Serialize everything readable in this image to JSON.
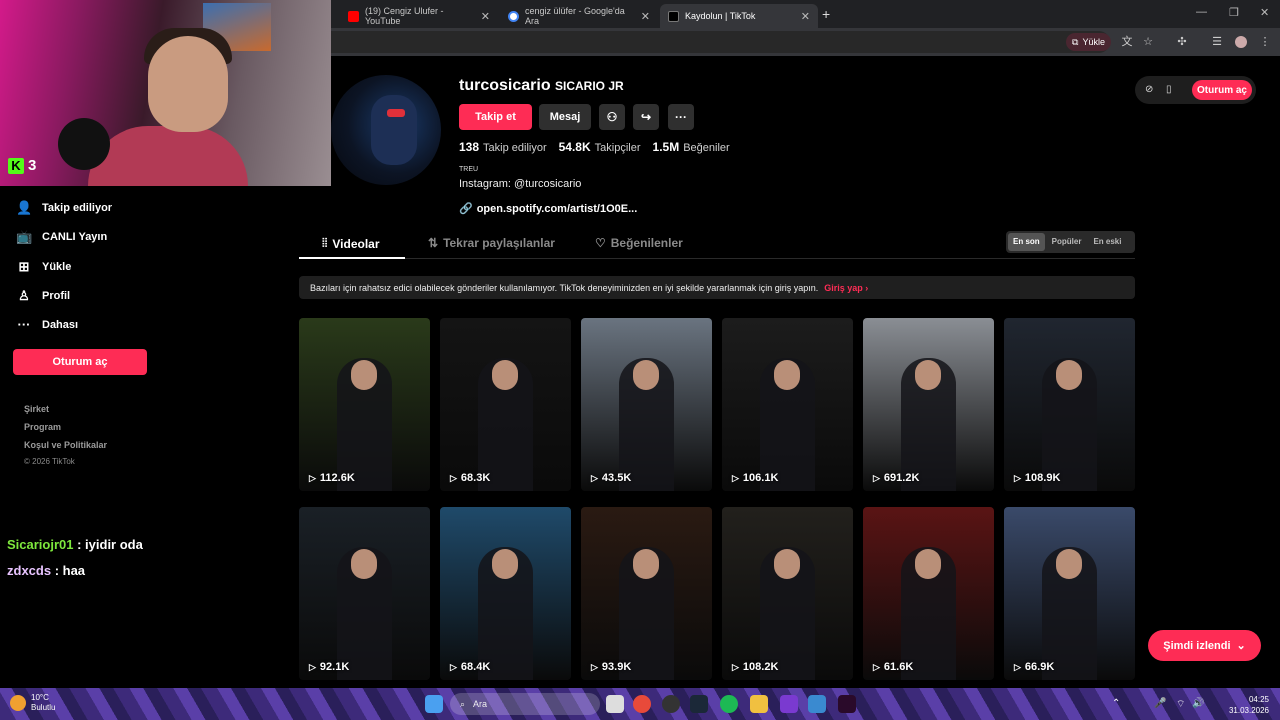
{
  "browser": {
    "tabs": [
      {
        "label": "(19) Cengiz Ulufer - YouTube",
        "icon": "youtube-icon",
        "active": false
      },
      {
        "label": "cengiz ülüfer - Google'da Ara",
        "icon": "google-icon",
        "active": false
      },
      {
        "label": "Kaydolun | TikTok",
        "icon": "tiktok-icon",
        "active": true
      }
    ],
    "install_label": "Yükle"
  },
  "webcam": {
    "kick_viewers": "3",
    "kick_logo": "K"
  },
  "sidebar": {
    "items": [
      {
        "label": "Takip ediliyor",
        "icon": "user-follow-icon"
      },
      {
        "label": "CANLI Yayın",
        "icon": "live-tv-icon"
      },
      {
        "label": "Yükle",
        "icon": "upload-plus-icon"
      },
      {
        "label": "Profil",
        "icon": "person-icon"
      },
      {
        "label": "Dahası",
        "icon": "more-dots-icon"
      }
    ],
    "login_label": "Oturum aç",
    "footer": [
      "Şirket",
      "Program",
      "Koşul ve Politikalar"
    ],
    "copyright": "© 2026 TikTok"
  },
  "chat": [
    {
      "user": "Sicariojr01",
      "message": " : iyidir oda"
    },
    {
      "user": "zdxcds",
      "message": " : haa"
    }
  ],
  "profile": {
    "username": "turcosicario",
    "nickname": "SICARIO JR",
    "follow_label": "Takip et",
    "message_label": "Mesaj",
    "stats": [
      {
        "value": "138",
        "label": "Takip ediliyor"
      },
      {
        "value": "54.8K",
        "label": "Takipçiler"
      },
      {
        "value": "1.5M",
        "label": "Beğeniler"
      }
    ],
    "bio_small": "TREU",
    "bio": "Instagram: @turcosicario",
    "link": "open.spotify.com/artist/1O0E..."
  },
  "header_right": {
    "login_label": "Oturum aç"
  },
  "tabs": [
    {
      "label": "Videolar",
      "icon": "grid-icon",
      "active": true
    },
    {
      "label": "Tekrar paylaşılanlar",
      "icon": "repost-icon",
      "active": false
    },
    {
      "label": "Beğenilenler",
      "icon": "heart-lock-icon",
      "active": false
    }
  ],
  "sort": {
    "options": [
      "En son",
      "Popüler",
      "En eski"
    ],
    "selected": "En son"
  },
  "notice": {
    "text": "Bazıları için rahatsız edici olabilecek gönderiler kullanılamıyor. TikTok deneyiminizden en iyi şekilde yararlanmak için giriş yapın.",
    "link": "Giriş yap"
  },
  "videos": [
    {
      "views": "112.6K",
      "color": "#2a3a1a"
    },
    {
      "views": "68.3K",
      "color": "#141414"
    },
    {
      "views": "43.5K",
      "color": "#6a7480"
    },
    {
      "views": "106.1K",
      "color": "#1c1c1c"
    },
    {
      "views": "691.2K",
      "color": "#8a8e94"
    },
    {
      "views": "108.9K",
      "color": "#202630"
    },
    {
      "views": "92.1K",
      "color": "#1a2026"
    },
    {
      "views": "68.4K",
      "color": "#1f4a6a"
    },
    {
      "views": "93.9K",
      "color": "#2a1a12"
    },
    {
      "views": "108.2K",
      "color": "#22201c"
    },
    {
      "views": "61.6K",
      "color": "#5a1414"
    },
    {
      "views": "66.9K",
      "color": "#3a4a6a"
    }
  ],
  "floating_button": "Şimdi izlendi",
  "taskbar": {
    "weather_temp": "10°C",
    "weather_desc": "Bulutlu",
    "search_placeholder": "Ara",
    "time": "04:25",
    "date": "31.03.2026"
  }
}
